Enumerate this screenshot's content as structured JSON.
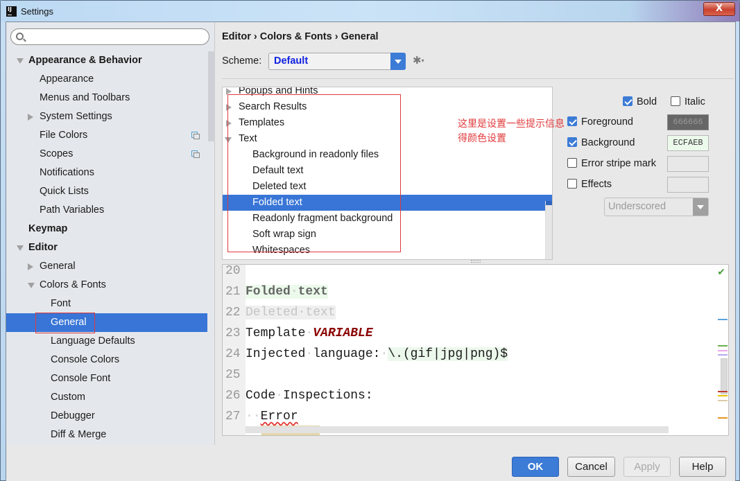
{
  "window": {
    "title": "Settings",
    "close_label": "X"
  },
  "search": {
    "placeholder": "",
    "value": ""
  },
  "sidebar": {
    "items": [
      {
        "label": "Appearance & Behavior",
        "level": 0,
        "bold": true,
        "expander": "down"
      },
      {
        "label": "Appearance",
        "level": 1
      },
      {
        "label": "Menus and Toolbars",
        "level": 1
      },
      {
        "label": "System Settings",
        "level": 1,
        "expander": "right"
      },
      {
        "label": "File Colors",
        "level": 1,
        "project_icon": true
      },
      {
        "label": "Scopes",
        "level": 1,
        "project_icon": true
      },
      {
        "label": "Notifications",
        "level": 1
      },
      {
        "label": "Quick Lists",
        "level": 1
      },
      {
        "label": "Path Variables",
        "level": 1
      },
      {
        "label": "Keymap",
        "level": 0,
        "bold": true
      },
      {
        "label": "Editor",
        "level": 0,
        "bold": true,
        "expander": "down"
      },
      {
        "label": "General",
        "level": 1,
        "expander": "right"
      },
      {
        "label": "Colors & Fonts",
        "level": 1,
        "expander": "down"
      },
      {
        "label": "Font",
        "level": 2
      },
      {
        "label": "General",
        "level": 2,
        "selected": true
      },
      {
        "label": "Language Defaults",
        "level": 2
      },
      {
        "label": "Console Colors",
        "level": 2
      },
      {
        "label": "Console Font",
        "level": 2
      },
      {
        "label": "Custom",
        "level": 2
      },
      {
        "label": "Debugger",
        "level": 2
      },
      {
        "label": "Diff & Merge",
        "level": 2
      }
    ]
  },
  "breadcrumb": "Editor › Colors & Fonts › General",
  "scheme": {
    "label": "Scheme:",
    "value": "Default"
  },
  "attributes": {
    "items": [
      {
        "label": "Popups and Hints",
        "level": 0,
        "expander": "right"
      },
      {
        "label": "Search Results",
        "level": 0,
        "expander": "right"
      },
      {
        "label": "Templates",
        "level": 0,
        "expander": "right"
      },
      {
        "label": "Text",
        "level": 0,
        "expander": "down"
      },
      {
        "label": "Background in readonly files",
        "level": 1
      },
      {
        "label": "Default text",
        "level": 1
      },
      {
        "label": "Deleted text",
        "level": 1
      },
      {
        "label": "Folded text",
        "level": 1,
        "selected": true
      },
      {
        "label": "Readonly fragment background",
        "level": 1
      },
      {
        "label": "Soft wrap sign",
        "level": 1
      },
      {
        "label": "Whitespaces",
        "level": 1
      }
    ]
  },
  "annotation": {
    "text": "这里是设置一些提示信息得颜色设置",
    "color": "#e0393b"
  },
  "options": {
    "bold": {
      "label": "Bold",
      "checked": true
    },
    "italic": {
      "label": "Italic",
      "checked": false
    },
    "foreground": {
      "label": "Foreground",
      "checked": true,
      "color": "666666",
      "swatch_bg": "#666666",
      "swatch_fg": "#999999"
    },
    "background": {
      "label": "Background",
      "checked": true,
      "color": "ECFAEB",
      "swatch_bg": "#ECFAEB",
      "swatch_fg": "#333333"
    },
    "error_stripe": {
      "label": "Error stripe mark",
      "checked": false,
      "color": ""
    },
    "effects": {
      "label": "Effects",
      "checked": false,
      "color": ""
    },
    "effect_type": "Underscored"
  },
  "preview": {
    "lines": [
      {
        "n": "20",
        "segments": []
      },
      {
        "n": "21",
        "segments": [
          {
            "t": "Folded",
            "c": "folded"
          },
          {
            "t": "·",
            "c": "folded ws"
          },
          {
            "t": "text",
            "c": "folded"
          }
        ]
      },
      {
        "n": "22",
        "segments": [
          {
            "t": "Deleted",
            "c": "deleted"
          },
          {
            "t": "·",
            "c": "deleted"
          },
          {
            "t": "text",
            "c": "deleted"
          }
        ]
      },
      {
        "n": "23",
        "segments": [
          {
            "t": "Template",
            "c": ""
          },
          {
            "t": "·",
            "c": "ws"
          },
          {
            "t": "VARIABLE",
            "c": "tmplvar"
          }
        ]
      },
      {
        "n": "24",
        "segments": [
          {
            "t": "Injected",
            "c": ""
          },
          {
            "t": "·",
            "c": "ws"
          },
          {
            "t": "language:",
            "c": ""
          },
          {
            "t": "·",
            "c": "ws"
          },
          {
            "t": "\\.(gif|jpg|png)$",
            "c": "inj"
          }
        ]
      },
      {
        "n": "25",
        "segments": []
      },
      {
        "n": "26",
        "segments": [
          {
            "t": "Code",
            "c": ""
          },
          {
            "t": "·",
            "c": "ws"
          },
          {
            "t": "Inspections:",
            "c": ""
          }
        ]
      },
      {
        "n": "27",
        "segments": [
          {
            "t": "··",
            "c": "ws"
          },
          {
            "t": "Error",
            "c": "err"
          }
        ]
      }
    ],
    "stripe_marks": [
      "#5ba3d9",
      "#6ab04c",
      "#e8a8e8",
      "#b4a8f0",
      "#c0392b",
      "#e6c200",
      "#d8cba8",
      "#e8961e"
    ]
  },
  "buttons": {
    "ok": "OK",
    "cancel": "Cancel",
    "apply": "Apply",
    "help": "Help"
  }
}
